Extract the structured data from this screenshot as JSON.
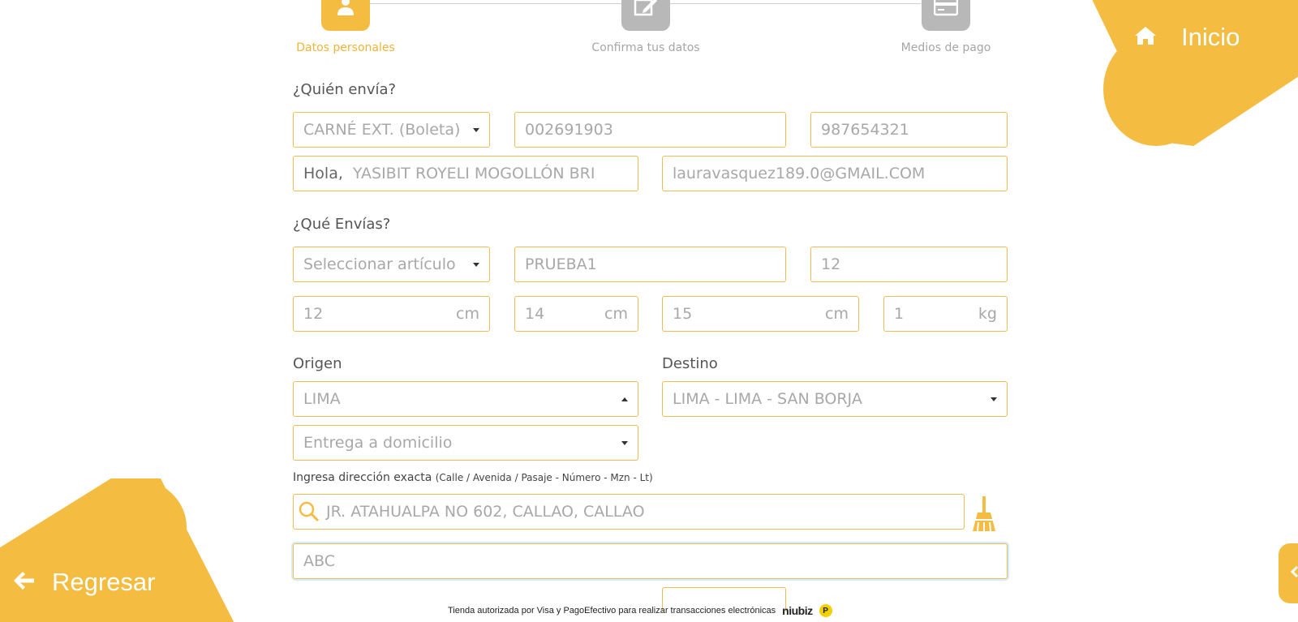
{
  "nav": {
    "home_label": "Inicio",
    "back_label": "Regresar"
  },
  "steps": [
    {
      "label": "Datos personales",
      "state": "active"
    },
    {
      "label": "Confirma tus datos",
      "state": "inactive"
    },
    {
      "label": "Medios de pago",
      "state": "inactive"
    }
  ],
  "sender": {
    "title": "¿Quién envía?",
    "doc_type": "CARNÉ EXT. (Boleta)",
    "doc_number": "002691903",
    "phone": "987654321",
    "greeting": "Hola,",
    "name": "YASIBIT ROYELI MOGOLLÓN BRI",
    "email": "lauravasquez189.0@GMAIL.COM"
  },
  "package": {
    "title": "¿Qué Envías?",
    "article_placeholder": "Seleccionar artículo",
    "description": "PRUEBA1",
    "quantity": "12",
    "length": "12",
    "width": "14",
    "height": "15",
    "weight": "1",
    "unit_cm": "cm",
    "unit_kg": "kg"
  },
  "route": {
    "origin_label": "Origen",
    "origin_value": "LIMA",
    "destination_label": "Destino",
    "destination_value": "LIMA - LIMA - SAN BORJA",
    "delivery_type": "Entrega a domicilio"
  },
  "address": {
    "label": "Ingresa dirección exacta",
    "hint": "(Calle / Avenida / Pasaje - Número - Mzn - Lt)",
    "search_value": "JR. ATAHUALPA NO 602, CALLAO, CALLAO",
    "reference_value": "ABC"
  },
  "footer": {
    "text": "Tienda autorizada por Visa y PagoEfectivo para realizar transacciones electrónicas",
    "brand": "niubiz",
    "pe_mark": "P"
  },
  "colors": {
    "accent": "#f4bd42",
    "border": "#f0bd52",
    "inactive_step": "#b8b8b8"
  }
}
